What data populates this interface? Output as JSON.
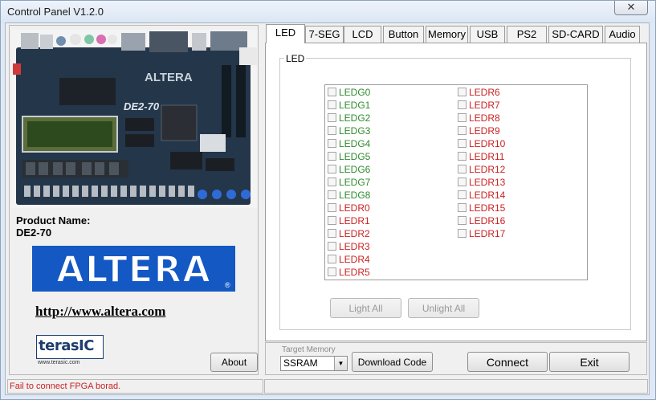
{
  "window": {
    "title": "Control Panel V1.2.0",
    "close_glyph": "✕"
  },
  "left": {
    "product_label": "Product Name:",
    "product_value": "DE2-70",
    "altera_logo": "ALTERA",
    "link": "http://www.altera.com",
    "terasic_logo": "terasIC",
    "terasic_url": "www.terasic.com",
    "about_label": "About",
    "board_silk": "DE2-70",
    "board_chip": "ALTERA"
  },
  "tabs": [
    {
      "label": "LED",
      "active": true
    },
    {
      "label": "7-SEG",
      "active": false
    },
    {
      "label": "LCD",
      "active": false
    },
    {
      "label": "Button",
      "active": false
    },
    {
      "label": "Memory",
      "active": false
    },
    {
      "label": "USB",
      "active": false
    },
    {
      "label": "PS2",
      "active": false
    },
    {
      "label": "SD-CARD",
      "active": false
    },
    {
      "label": "Audio",
      "active": false
    }
  ],
  "led_panel": {
    "group_title": "LED",
    "leds": [
      {
        "name": "LEDG0",
        "color": "green",
        "checked": false
      },
      {
        "name": "LEDG1",
        "color": "green",
        "checked": false
      },
      {
        "name": "LEDG2",
        "color": "green",
        "checked": false
      },
      {
        "name": "LEDG3",
        "color": "green",
        "checked": false
      },
      {
        "name": "LEDG4",
        "color": "green",
        "checked": false
      },
      {
        "name": "LEDG5",
        "color": "green",
        "checked": false
      },
      {
        "name": "LEDG6",
        "color": "green",
        "checked": false
      },
      {
        "name": "LEDG7",
        "color": "green",
        "checked": false
      },
      {
        "name": "LEDG8",
        "color": "green",
        "checked": false
      },
      {
        "name": "LEDR0",
        "color": "red",
        "checked": false
      },
      {
        "name": "LEDR1",
        "color": "red",
        "checked": false
      },
      {
        "name": "LEDR2",
        "color": "red",
        "checked": false
      },
      {
        "name": "LEDR3",
        "color": "red",
        "checked": false
      },
      {
        "name": "LEDR4",
        "color": "red",
        "checked": false
      },
      {
        "name": "LEDR5",
        "color": "red",
        "checked": false
      },
      {
        "name": "LEDR6",
        "color": "red",
        "checked": false
      },
      {
        "name": "LEDR7",
        "color": "red",
        "checked": false
      },
      {
        "name": "LEDR8",
        "color": "red",
        "checked": false
      },
      {
        "name": "LEDR9",
        "color": "red",
        "checked": false
      },
      {
        "name": "LEDR10",
        "color": "red",
        "checked": false
      },
      {
        "name": "LEDR11",
        "color": "red",
        "checked": false
      },
      {
        "name": "LEDR12",
        "color": "red",
        "checked": false
      },
      {
        "name": "LEDR13",
        "color": "red",
        "checked": false
      },
      {
        "name": "LEDR14",
        "color": "red",
        "checked": false
      },
      {
        "name": "LEDR15",
        "color": "red",
        "checked": false
      },
      {
        "name": "LEDR16",
        "color": "red",
        "checked": false
      },
      {
        "name": "LEDR17",
        "color": "red",
        "checked": false
      }
    ],
    "light_all_label": "Light All",
    "unlight_all_label": "Unlight All",
    "buttons_enabled": false
  },
  "bottom": {
    "target_memory_label": "Target Memory",
    "target_memory_value": "SSRAM",
    "download_label": "Download Code",
    "connect_label": "Connect",
    "exit_label": "Exit"
  },
  "status": {
    "message": "Fail to connect FPGA borad."
  },
  "colors": {
    "led_green": "#2e8b2e",
    "led_red": "#cc2222",
    "altera_blue": "#1458c4",
    "status_error": "#cc2222"
  }
}
